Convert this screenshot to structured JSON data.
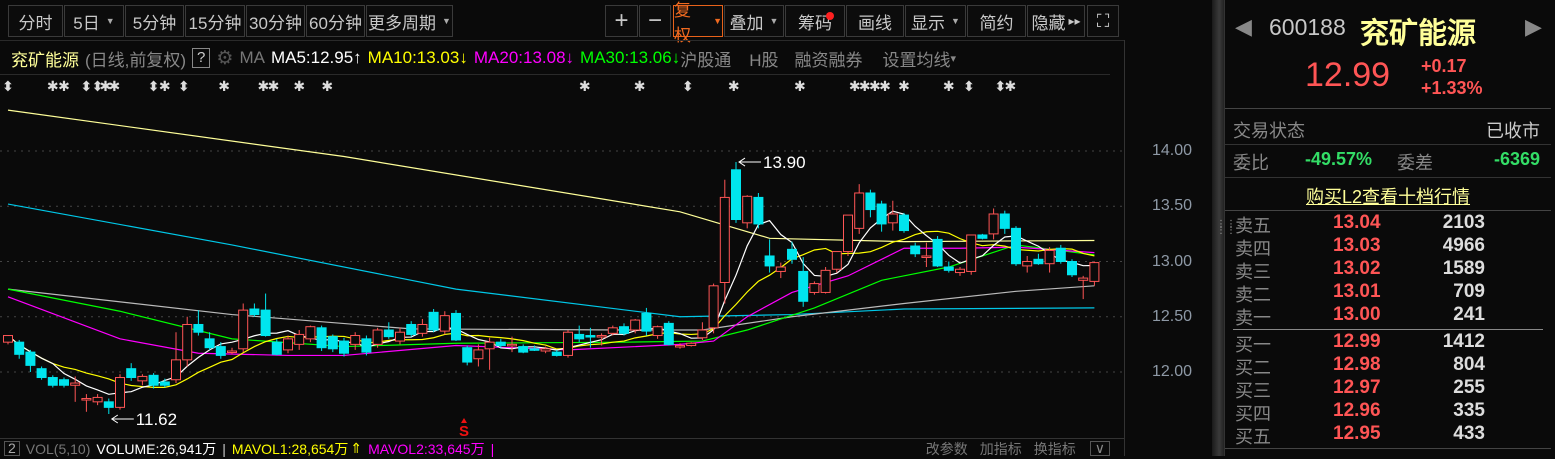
{
  "toolbar": {
    "periods": [
      {
        "label": "分时"
      },
      {
        "label": "5日",
        "dd": true
      },
      {
        "label": "5分钟"
      },
      {
        "label": "15分钟"
      },
      {
        "label": "30分钟"
      },
      {
        "label": "60分钟"
      },
      {
        "label": "更多周期",
        "dd": true
      }
    ],
    "plus": "+",
    "minus": "−",
    "fuquan": "复权",
    "diejia": "叠加",
    "chouma": "筹码",
    "huaxian": "画线",
    "xianshi": "显示",
    "jianyue": "简约",
    "yincang": "隐藏",
    "yincang_arrows": "▸▸",
    "fullscreen": "⛶"
  },
  "info": {
    "name": "兖矿能源",
    "mode": "(日线,前复权)",
    "help": "?",
    "ma": "MA",
    "ma5": "MA5:12.95",
    "ma5_arrow": "↑",
    "ma10": "MA10:13.03",
    "ma10_arrow": "↓",
    "ma20": "MA20:13.08",
    "ma20_arrow": "↓",
    "ma30": "MA30:13.06",
    "ma30_arrow": "↓",
    "hgt": "沪股通",
    "hgu": "H股",
    "rzrq": "融资融券",
    "setma": "设置均线",
    "setma_dd": "▾"
  },
  "colors": {
    "up": "#ff5555",
    "down": "#00e5ee",
    "ma5": "#ffffff",
    "ma10": "#ffff00",
    "ma20": "#ff00ff",
    "ma30": "#00ff00",
    "long1": "#ffff99",
    "long2": "#00c8e8",
    "long3": "#bbbbbb",
    "accent": "#f06a20"
  },
  "chart_data": {
    "type": "candlestick",
    "ylim": [
      11.45,
      14.5
    ],
    "yticks": [
      "14.00",
      "13.50",
      "13.00",
      "12.50",
      "12.00"
    ],
    "ytick_values": [
      14,
      13.5,
      13,
      12.5,
      12
    ],
    "ohlc": [
      [
        12.27,
        12.33,
        12.25,
        12.33
      ],
      [
        12.27,
        12.29,
        12.12,
        12.16
      ],
      [
        12.18,
        12.2,
        12.0,
        12.06
      ],
      [
        12.03,
        12.05,
        11.93,
        11.95
      ],
      [
        11.95,
        11.97,
        11.86,
        11.88
      ],
      [
        11.93,
        11.95,
        11.86,
        11.88
      ],
      [
        11.88,
        11.96,
        11.73,
        11.9
      ],
      [
        11.75,
        11.8,
        11.64,
        11.76
      ],
      [
        11.73,
        11.8,
        11.7,
        11.77
      ],
      [
        11.73,
        11.76,
        11.62,
        11.68
      ],
      [
        11.68,
        11.98,
        11.66,
        11.95
      ],
      [
        12.03,
        12.08,
        11.92,
        11.95
      ],
      [
        11.92,
        11.98,
        11.88,
        11.96
      ],
      [
        11.97,
        11.99,
        11.85,
        11.88
      ],
      [
        11.91,
        11.94,
        11.86,
        11.88
      ],
      [
        11.93,
        12.36,
        11.9,
        12.11
      ],
      [
        12.11,
        12.5,
        12.05,
        12.43
      ],
      [
        12.43,
        12.56,
        12.33,
        12.36
      ],
      [
        12.3,
        12.36,
        12.2,
        12.22
      ],
      [
        12.23,
        12.27,
        12.12,
        12.15
      ],
      [
        12.19,
        12.22,
        12.16,
        12.19
      ],
      [
        12.21,
        12.62,
        12.18,
        12.56
      ],
      [
        12.57,
        12.62,
        12.5,
        12.52
      ],
      [
        12.56,
        12.71,
        12.32,
        12.33
      ],
      [
        12.27,
        12.3,
        12.15,
        12.16
      ],
      [
        12.2,
        12.33,
        12.17,
        12.3
      ],
      [
        12.25,
        12.38,
        12.2,
        12.34
      ],
      [
        12.3,
        12.42,
        12.27,
        12.41
      ],
      [
        12.4,
        12.42,
        12.19,
        12.22
      ],
      [
        12.32,
        12.34,
        12.18,
        12.21
      ],
      [
        12.28,
        12.31,
        12.14,
        12.17
      ],
      [
        12.25,
        12.36,
        12.2,
        12.33
      ],
      [
        12.3,
        12.33,
        12.15,
        12.18
      ],
      [
        12.25,
        12.4,
        12.22,
        12.38
      ],
      [
        12.38,
        12.45,
        12.3,
        12.32
      ],
      [
        12.28,
        12.4,
        12.25,
        12.36
      ],
      [
        12.43,
        12.46,
        12.32,
        12.34
      ],
      [
        12.35,
        12.48,
        12.32,
        12.43
      ],
      [
        12.54,
        12.57,
        12.36,
        12.38
      ],
      [
        12.37,
        12.55,
        12.34,
        12.51
      ],
      [
        12.53,
        12.56,
        12.28,
        12.29
      ],
      [
        12.22,
        12.24,
        12.06,
        12.09
      ],
      [
        12.12,
        12.25,
        12.05,
        12.2
      ],
      [
        12.21,
        12.31,
        12.02,
        12.27
      ],
      [
        12.27,
        12.3,
        12.22,
        12.24
      ],
      [
        12.25,
        12.32,
        12.18,
        12.25
      ],
      [
        12.23,
        12.25,
        12.17,
        12.18
      ],
      [
        12.21,
        12.24,
        12.19,
        12.2
      ],
      [
        12.19,
        12.23,
        12.17,
        12.21
      ],
      [
        12.18,
        12.2,
        12.14,
        12.15
      ],
      [
        12.15,
        12.38,
        12.13,
        12.36
      ],
      [
        12.34,
        12.42,
        12.27,
        12.3
      ],
      [
        12.33,
        12.4,
        12.22,
        12.32
      ],
      [
        12.32,
        12.35,
        12.24,
        12.33
      ],
      [
        12.35,
        12.42,
        12.33,
        12.4
      ],
      [
        12.41,
        12.44,
        12.33,
        12.35
      ],
      [
        12.38,
        12.48,
        12.35,
        12.47
      ],
      [
        12.53,
        12.58,
        12.33,
        12.37
      ],
      [
        12.33,
        12.42,
        12.3,
        12.41
      ],
      [
        12.44,
        12.46,
        12.24,
        12.25
      ],
      [
        12.23,
        12.26,
        12.21,
        12.24
      ],
      [
        12.24,
        12.27,
        12.23,
        12.26
      ],
      [
        12.31,
        12.45,
        12.29,
        12.38
      ],
      [
        12.4,
        12.8,
        12.35,
        12.78
      ],
      [
        12.81,
        13.74,
        12.62,
        13.58
      ],
      [
        13.83,
        13.9,
        13.35,
        13.38
      ],
      [
        13.35,
        13.6,
        13.3,
        13.59
      ],
      [
        13.58,
        13.62,
        13.3,
        13.34
      ],
      [
        13.05,
        13.2,
        12.9,
        12.96
      ],
      [
        12.91,
        12.99,
        12.85,
        12.95
      ],
      [
        13.11,
        13.18,
        12.98,
        13.02
      ],
      [
        12.91,
        13.04,
        12.59,
        12.64
      ],
      [
        12.72,
        12.82,
        12.7,
        12.8
      ],
      [
        12.72,
        12.95,
        12.71,
        12.92
      ],
      [
        12.93,
        13.04,
        12.9,
        13.09
      ],
      [
        13.09,
        13.42,
        13.05,
        13.42
      ],
      [
        13.3,
        13.7,
        13.25,
        13.62
      ],
      [
        13.62,
        13.65,
        13.4,
        13.47
      ],
      [
        13.52,
        13.55,
        13.27,
        13.34
      ],
      [
        13.35,
        13.55,
        13.28,
        13.43
      ],
      [
        13.42,
        13.44,
        13.26,
        13.28
      ],
      [
        13.14,
        13.17,
        13.04,
        13.07
      ],
      [
        13.05,
        13.17,
        12.95,
        13.05
      ],
      [
        13.2,
        13.23,
        12.95,
        12.96
      ],
      [
        12.95,
        13.0,
        12.9,
        12.92
      ],
      [
        12.9,
        12.95,
        12.87,
        12.93
      ],
      [
        12.91,
        13.23,
        12.88,
        13.24
      ],
      [
        13.24,
        13.25,
        13.2,
        13.21
      ],
      [
        13.25,
        13.48,
        13.2,
        13.43
      ],
      [
        13.43,
        13.46,
        13.25,
        13.3
      ],
      [
        13.3,
        13.32,
        12.96,
        12.98
      ],
      [
        12.96,
        13.05,
        12.9,
        13.0
      ],
      [
        13.02,
        13.07,
        12.97,
        12.98
      ],
      [
        12.98,
        13.13,
        12.9,
        13.1
      ],
      [
        13.12,
        13.15,
        12.98,
        13.0
      ],
      [
        13.0,
        13.02,
        12.86,
        12.88
      ],
      [
        12.83,
        12.87,
        12.66,
        12.85
      ],
      [
        12.82,
        13.0,
        12.78,
        12.99
      ]
    ],
    "ma20": [
      [
        0,
        12.68
      ],
      [
        10,
        12.3
      ],
      [
        17,
        12.17
      ],
      [
        25,
        12.15
      ],
      [
        30,
        12.15
      ],
      [
        40,
        12.24
      ],
      [
        50,
        12.2
      ],
      [
        60,
        12.25
      ],
      [
        63,
        12.28
      ],
      [
        66,
        12.5
      ],
      [
        70,
        12.72
      ],
      [
        75,
        12.87
      ],
      [
        80,
        13.12
      ],
      [
        85,
        13.12
      ],
      [
        90,
        13.13
      ],
      [
        97,
        13.08
      ]
    ],
    "ma30": [
      [
        0,
        12.75
      ],
      [
        10,
        12.55
      ],
      [
        20,
        12.3
      ],
      [
        30,
        12.23
      ],
      [
        40,
        12.26
      ],
      [
        55,
        12.27
      ],
      [
        62,
        12.28
      ],
      [
        66,
        12.38
      ],
      [
        72,
        12.58
      ],
      [
        78,
        12.83
      ],
      [
        84,
        12.95
      ],
      [
        90,
        13.15
      ],
      [
        97,
        13.06
      ]
    ],
    "long1": [
      [
        0,
        14.37
      ],
      [
        30,
        13.95
      ],
      [
        60,
        13.45
      ],
      [
        68,
        13.21
      ],
      [
        80,
        13.18
      ],
      [
        97,
        13.19
      ]
    ],
    "long2": [
      [
        0,
        13.52
      ],
      [
        20,
        13.15
      ],
      [
        40,
        12.75
      ],
      [
        60,
        12.5
      ],
      [
        70,
        12.52
      ],
      [
        80,
        12.57
      ],
      [
        97,
        12.58
      ]
    ],
    "long3": [
      [
        0,
        12.75
      ],
      [
        20,
        12.52
      ],
      [
        36,
        12.39
      ],
      [
        55,
        12.38
      ],
      [
        62,
        12.38
      ],
      [
        70,
        12.5
      ],
      [
        80,
        12.62
      ],
      [
        90,
        12.73
      ],
      [
        97,
        12.78
      ]
    ],
    "high_label": "13.90",
    "high_index": 65,
    "low_label": "11.62",
    "low_index": 9,
    "signal": "S",
    "signal_index": 40,
    "markers": [
      [
        0,
        "⬍"
      ],
      [
        4,
        "✱"
      ],
      [
        5,
        "✱"
      ],
      [
        7,
        "⬍"
      ],
      [
        8,
        "⬍"
      ],
      [
        8.7,
        "✱"
      ],
      [
        9.5,
        "✱"
      ],
      [
        13,
        "⬍"
      ],
      [
        14,
        "✱"
      ],
      [
        15.7,
        "⬍"
      ],
      [
        19.3,
        "✱"
      ],
      [
        22.8,
        "✱"
      ],
      [
        23.7,
        "✱"
      ],
      [
        26,
        "✱"
      ],
      [
        28.5,
        "✱"
      ],
      [
        51.5,
        "✱"
      ],
      [
        56.4,
        "✱"
      ],
      [
        60.7,
        "⬍"
      ],
      [
        64.8,
        "✱"
      ],
      [
        70.7,
        "✱"
      ],
      [
        75.6,
        "✱"
      ],
      [
        76.5,
        "✱"
      ],
      [
        77.4,
        "✱"
      ],
      [
        78.3,
        "✱"
      ],
      [
        80,
        "✱"
      ],
      [
        84,
        "✱"
      ],
      [
        85.8,
        "⬍"
      ],
      [
        88.6,
        "⬍"
      ],
      [
        89.5,
        "✱"
      ]
    ]
  },
  "bottom": {
    "box": "2",
    "vol": "VOL(5,10)",
    "volume": "VOLUME:26,941万",
    "sep": "|",
    "mavol1": "MAVOL1:28,654万",
    "mavol1_arrow": "⇑",
    "mavol2": "MAVOL2:33,645万",
    "sep2": "|",
    "gcs": "改参数",
    "jzb": "加指标",
    "hzb": "换指标",
    "more": "∨"
  },
  "quote": {
    "code": "600188",
    "name": "兖矿能源",
    "price": "12.99",
    "change": "+0.17",
    "pct": "+1.33%",
    "status_label": "交易状态",
    "status": "已收市",
    "wb_label": "委比",
    "wb": "-49.57%",
    "wc_label": "委差",
    "wc": "-6369",
    "l2": "购买L2查看十档行情",
    "asks": [
      {
        "label": "卖五",
        "price": "13.04",
        "vol": "2103"
      },
      {
        "label": "卖四",
        "price": "13.03",
        "vol": "4966"
      },
      {
        "label": "卖三",
        "price": "13.02",
        "vol": "1589"
      },
      {
        "label": "卖二",
        "price": "13.01",
        "vol": "709"
      },
      {
        "label": "卖一",
        "price": "13.00",
        "vol": "241"
      }
    ],
    "bids": [
      {
        "label": "买一",
        "price": "12.99",
        "vol": "1412"
      },
      {
        "label": "买二",
        "price": "12.98",
        "vol": "804"
      },
      {
        "label": "买三",
        "price": "12.97",
        "vol": "255"
      },
      {
        "label": "买四",
        "price": "12.96",
        "vol": "335"
      },
      {
        "label": "买五",
        "price": "12.95",
        "vol": "433"
      }
    ]
  }
}
